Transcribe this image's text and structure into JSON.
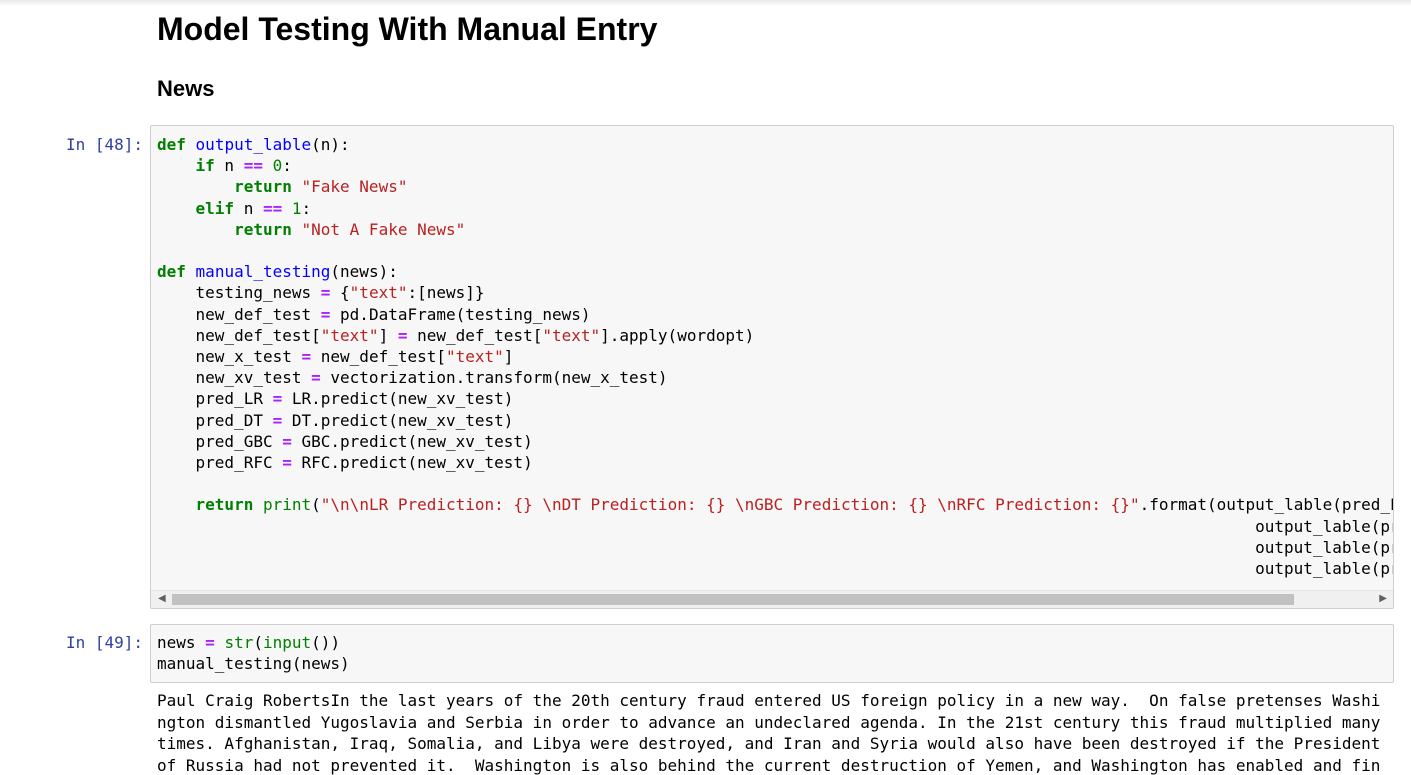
{
  "notebook": {
    "heading": "Model Testing With Manual Entry",
    "subheading": "News"
  },
  "cells": [
    {
      "prompt": "In [48]:",
      "code_lines": [
        "def output_lable(n):",
        "    if n == 0:",
        "        return \"Fake News\"",
        "    elif n == 1:",
        "        return \"Not A Fake News\"",
        "",
        "def manual_testing(news):",
        "    testing_news = {\"text\":[news]}",
        "    new_def_test = pd.DataFrame(testing_news)",
        "    new_def_test[\"text\"] = new_def_test[\"text\"].apply(wordopt)",
        "    new_x_test = new_def_test[\"text\"]",
        "    new_xv_test = vectorization.transform(new_x_test)",
        "    pred_LR = LR.predict(new_xv_test)",
        "    pred_DT = DT.predict(new_xv_test)",
        "    pred_GBC = GBC.predict(new_xv_test)",
        "    pred_RFC = RFC.predict(new_xv_test)",
        "",
        "    return print(\"\\n\\nLR Prediction: {} \\nDT Prediction: {} \\nGBC Prediction: {} \\nRFC Prediction: {}\".format(output_lable(pred_L",
        "                                                                                                                  output_lable(pred_D",
        "                                                                                                                  output_lable(pred_G",
        "                                                                                                                  output_lable(pred_R"
      ]
    },
    {
      "prompt": "In [49]:",
      "code_lines": [
        "news = str(input())",
        "manual_testing(news)"
      ],
      "output_lines": [
        "Paul Craig RobertsIn the last years of the 20th century fraud entered US foreign policy in a new way.  On false pretenses Washi",
        "ngton dismantled Yugoslavia and Serbia in order to advance an undeclared agenda. In the 21st century this fraud multiplied many",
        "times. Afghanistan, Iraq, Somalia, and Libya were destroyed, and Iran and Syria would also have been destroyed if the President",
        "of Russia had not prevented it.  Washington is also behind the current destruction of Yemen, and Washington has enabled and fin"
      ]
    }
  ],
  "icons": {
    "scroll_left": "triangle-left-icon",
    "scroll_right": "triangle-right-icon"
  },
  "colors": {
    "prompt": "#303f9f",
    "keyword": "#008000",
    "string": "#ba2121",
    "operator": "#aa22ff",
    "function_name": "#0000ff",
    "cell_background": "#f7f7f7",
    "cell_border": "#cfcfcf"
  }
}
